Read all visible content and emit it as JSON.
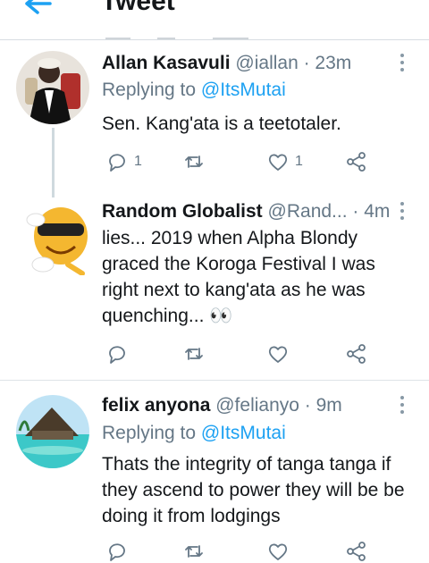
{
  "header": {
    "title": "Tweet"
  },
  "tweets": [
    {
      "name": "Allan Kasavuli",
      "handle": "@iallan",
      "time": "· 23m",
      "replying_prefix": "Replying to",
      "replying_to": "@ItsMutai",
      "text": "Sen. Kang'ata is a teetotaler.",
      "actions": {
        "reply_count": "1",
        "like_count": "1"
      }
    },
    {
      "name": "Random Globalist",
      "handle": "@Rand...",
      "time": "· 4m",
      "text": "lies... 2019 when Alpha Blondy graced the Koroga Festival I was right next to kang'ata as he was quenching... 👀",
      "actions": {}
    },
    {
      "name": "felix anyona",
      "handle": "@felianyo",
      "time": "· 9m",
      "replying_prefix": "Replying to",
      "replying_to": "@ItsMutai",
      "text": "Thats the integrity of tanga tanga if they ascend to power they will be be doing it from lodgings",
      "actions": {}
    }
  ],
  "colors": {
    "accent": "#1da1f2",
    "muted": "#657786",
    "text": "#14171a"
  },
  "icons": [
    "back-arrow-icon",
    "more-icon",
    "reply-icon",
    "retweet-icon",
    "like-icon",
    "share-icon"
  ]
}
